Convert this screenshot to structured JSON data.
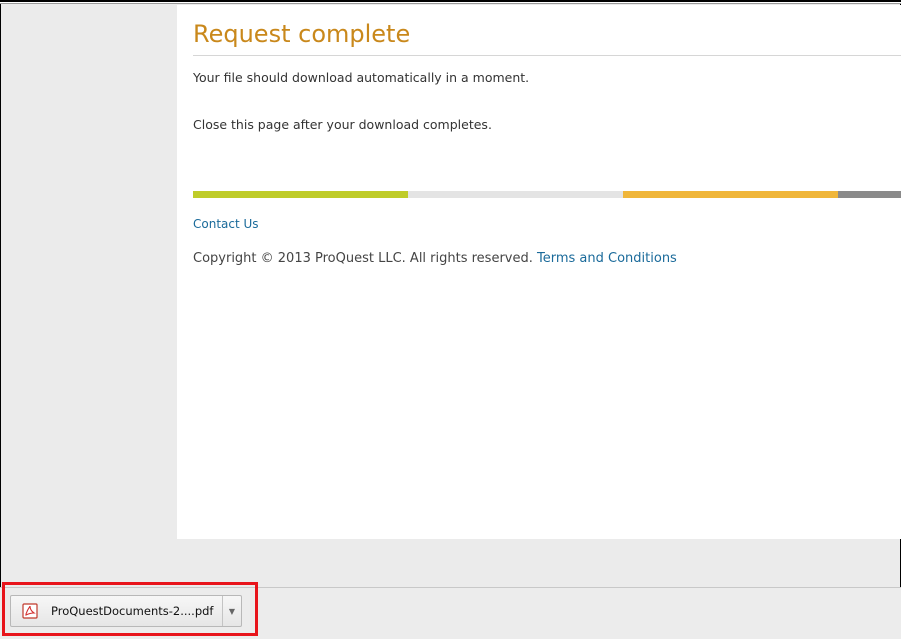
{
  "page": {
    "title": "Request complete",
    "message_line1": "Your file should download automatically in a moment.",
    "message_line2": "Close this page after your download completes."
  },
  "footer": {
    "contact_label": "Contact Us",
    "copyright_text": "Copyright © 2013 ProQuest LLC. All rights reserved.",
    "terms_label": "Terms and Conditions"
  },
  "colorbar": {
    "segments": [
      "#bfcc29",
      "#e4e4e4",
      "#f0b63a",
      "#8a8a8a"
    ]
  },
  "download_bar": {
    "file_name": "ProQuestDocuments-2....pdf",
    "file_icon": "pdf-icon",
    "menu_icon": "chevron-down-icon"
  },
  "colors": {
    "title": "#c9881b",
    "link": "#1a6a9a",
    "highlight": "#e8141b"
  }
}
